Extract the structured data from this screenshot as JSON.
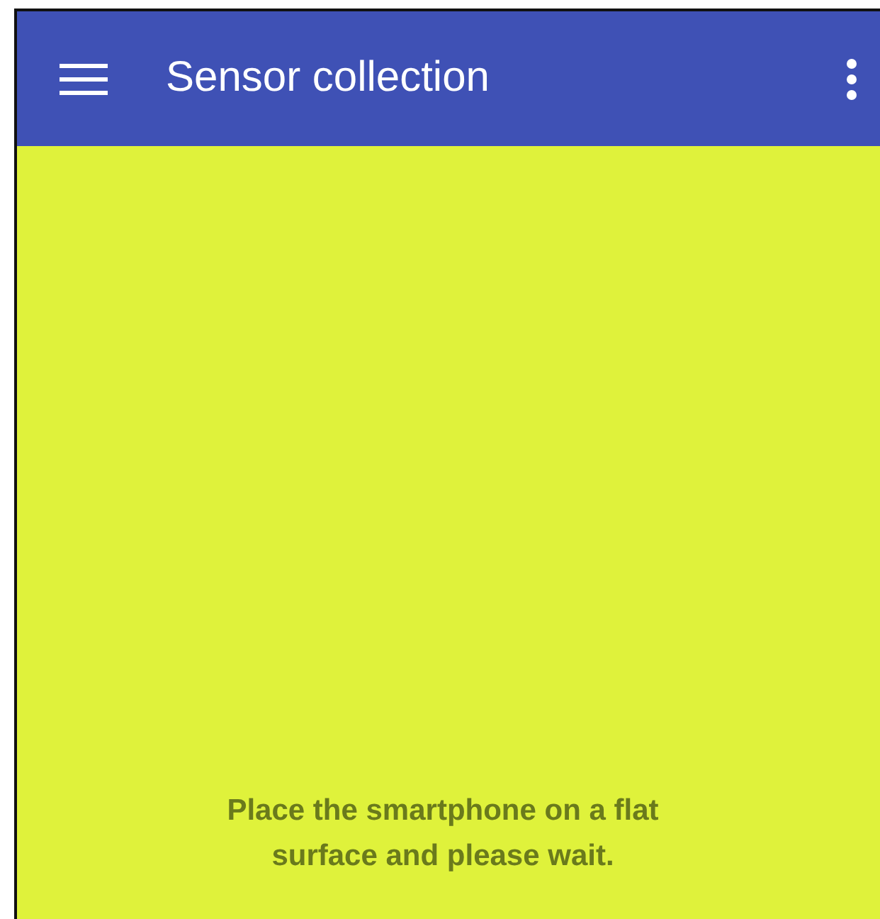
{
  "app_bar": {
    "title": "Sensor collection"
  },
  "message": "Place the smartphone on a flat surface and please wait."
}
